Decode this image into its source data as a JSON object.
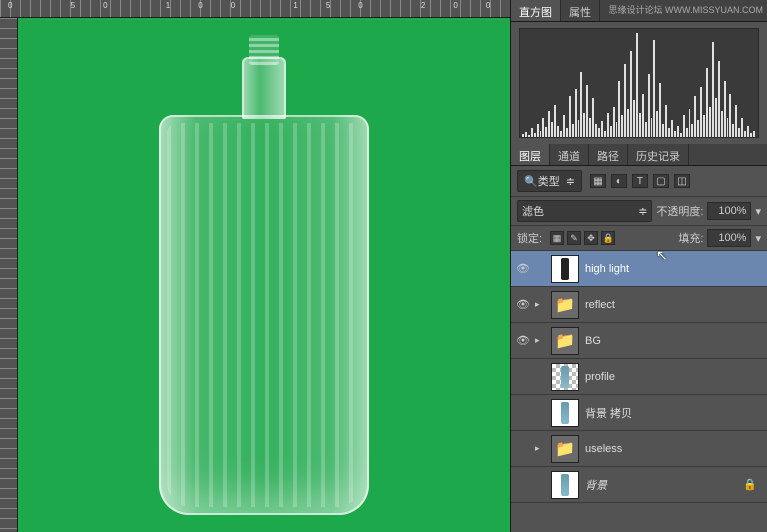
{
  "watermark": "思缘设计论坛 WWW.MISSYUAN.COM",
  "histogram_panel": {
    "tabs": [
      "直方图",
      "属性"
    ]
  },
  "layers_panel": {
    "tabs": [
      "图层",
      "通道",
      "路径",
      "历史记录"
    ],
    "filter_label": "类型",
    "blend_mode": "滤色",
    "opacity_label": "不透明度:",
    "opacity_value": "100%",
    "lock_label": "锁定:",
    "fill_label": "填充:",
    "fill_value": "100%",
    "layers": [
      {
        "name": "high light",
        "visible": true,
        "selected": true,
        "kind": "layer-dark"
      },
      {
        "name": "reflect",
        "visible": true,
        "kind": "group"
      },
      {
        "name": "BG",
        "visible": true,
        "kind": "group"
      },
      {
        "name": "profile",
        "visible": false,
        "kind": "layer-checker"
      },
      {
        "name": "背景 拷贝",
        "visible": false,
        "kind": "layer-bottle"
      },
      {
        "name": "useless",
        "visible": false,
        "kind": "group"
      },
      {
        "name": "背景",
        "visible": false,
        "kind": "layer-bottle",
        "italic": true,
        "locked": true
      }
    ]
  },
  "hist_bars": [
    3,
    5,
    2,
    8,
    4,
    12,
    6,
    18,
    9,
    24,
    14,
    30,
    10,
    6,
    20,
    8,
    38,
    12,
    44,
    16,
    60,
    22,
    48,
    18,
    36,
    12,
    8,
    15,
    6,
    22,
    10,
    28,
    14,
    52,
    20,
    68,
    26,
    80,
    34,
    96,
    22,
    40,
    14,
    58,
    18,
    90,
    24,
    50,
    12,
    30,
    8,
    16,
    6,
    10,
    4,
    20,
    8,
    26,
    12,
    38,
    16,
    46,
    20,
    64,
    28,
    88,
    36,
    70,
    24,
    52,
    18,
    40,
    12,
    30,
    8,
    18,
    6,
    10,
    4,
    6
  ]
}
